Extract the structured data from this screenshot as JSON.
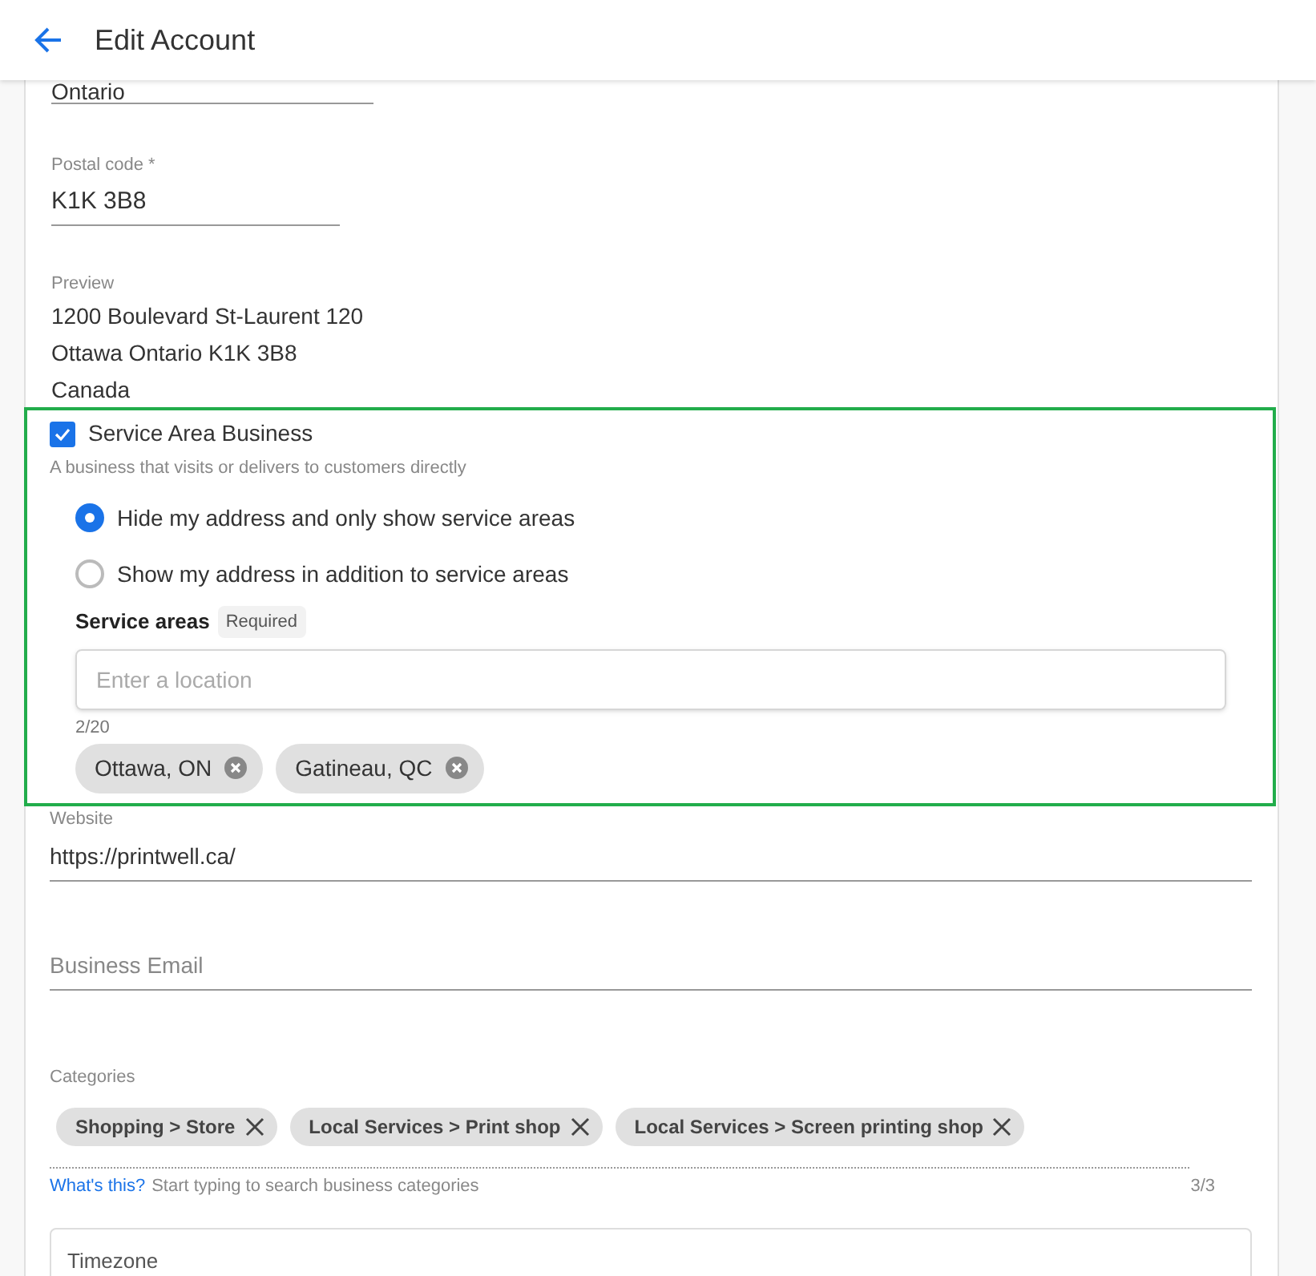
{
  "header": {
    "title": "Edit Account"
  },
  "province": {
    "value": "Ontario"
  },
  "postal_code": {
    "label": "Postal code *",
    "value": "K1K 3B8"
  },
  "preview": {
    "label": "Preview",
    "lines": [
      "1200 Boulevard St-Laurent 120",
      "Ottawa Ontario K1K 3B8",
      "Canada"
    ]
  },
  "service_area": {
    "label": "Service Area Business",
    "checked": true,
    "description": "A business that visits or delivers to customers directly",
    "options": [
      {
        "label": "Hide my address and only show service areas",
        "selected": true
      },
      {
        "label": "Show my address in addition to service areas",
        "selected": false
      }
    ],
    "areas_label": "Service areas",
    "required_badge": "Required",
    "placeholder": "Enter a location",
    "count": "2/20",
    "areas": [
      "Ottawa, ON",
      "Gatineau, QC"
    ]
  },
  "website": {
    "label": "Website",
    "value": "https://printwell.ca/"
  },
  "business_email": {
    "placeholder": "Business Email"
  },
  "categories": {
    "label": "Categories",
    "items": [
      "Shopping > Store",
      "Local Services > Print shop",
      "Local Services > Screen printing shop"
    ],
    "help_link": "What's this?",
    "hint": "Start typing to search business categories",
    "count": "3/3"
  },
  "timezone": {
    "label": "Timezone"
  }
}
